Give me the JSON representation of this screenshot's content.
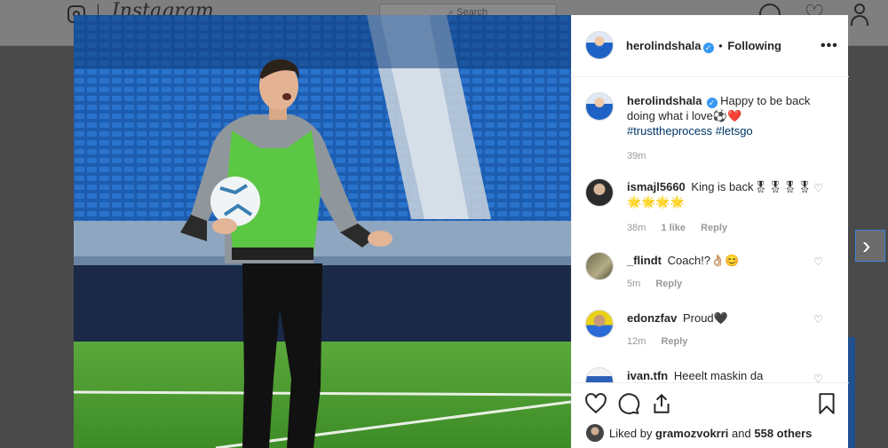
{
  "background": {
    "brand": "Instagram",
    "search_placeholder": "Search"
  },
  "post": {
    "author": "herolindshala",
    "follow_status": "Following",
    "caption": "Happy to be back doing what i love⚽❤️",
    "hashtags": [
      "#trusttheprocess",
      "#letsgo"
    ],
    "caption_time": "39m"
  },
  "comments": [
    {
      "user": "ismajl5660",
      "text": "King is back🎖🎖🎖🎖🌟🌟🌟🌟",
      "time": "38m",
      "likes": "1 like",
      "reply": "Reply"
    },
    {
      "user": "_flindt",
      "text": "Coach!?👌🏼😊",
      "time": "5m",
      "likes": "",
      "reply": "Reply"
    },
    {
      "user": "edonzfav",
      "text": "Proud🖤",
      "time": "12m",
      "likes": "",
      "reply": "Reply"
    },
    {
      "user": "ivan.tfn",
      "text": "Heeelt maskin da",
      "time": "",
      "likes": "",
      "reply": ""
    }
  ],
  "likes_summary": {
    "prefix": "Liked by",
    "user": "gramozvokrri",
    "conjunction": "and",
    "others": "558 others"
  },
  "colors": {
    "verified": "#3897f0",
    "hashtag": "#003569",
    "pitch_green": "#3f9a2b",
    "stadium_blue": "#1c5aa6",
    "bib_green": "#59c53f"
  }
}
